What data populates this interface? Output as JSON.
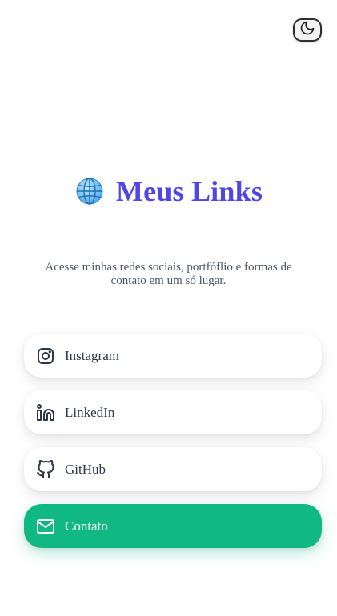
{
  "theme_toggle": {
    "icon": "moon-icon"
  },
  "header": {
    "emoji": "🌐",
    "title": "Meus Links",
    "subtitle": "Acesse minhas redes sociais, portfóflio e formas de contato em um só lugar."
  },
  "links": [
    {
      "label": "Instagram",
      "icon": "instagram-icon"
    },
    {
      "label": "LinkedIn",
      "icon": "linkedin-icon"
    },
    {
      "label": "GitHub",
      "icon": "github-icon"
    },
    {
      "label": "Contato",
      "icon": "mail-icon"
    }
  ],
  "colors": {
    "title": "#4f46e5",
    "contact_button": "#10b981",
    "text": "#2d3748"
  }
}
